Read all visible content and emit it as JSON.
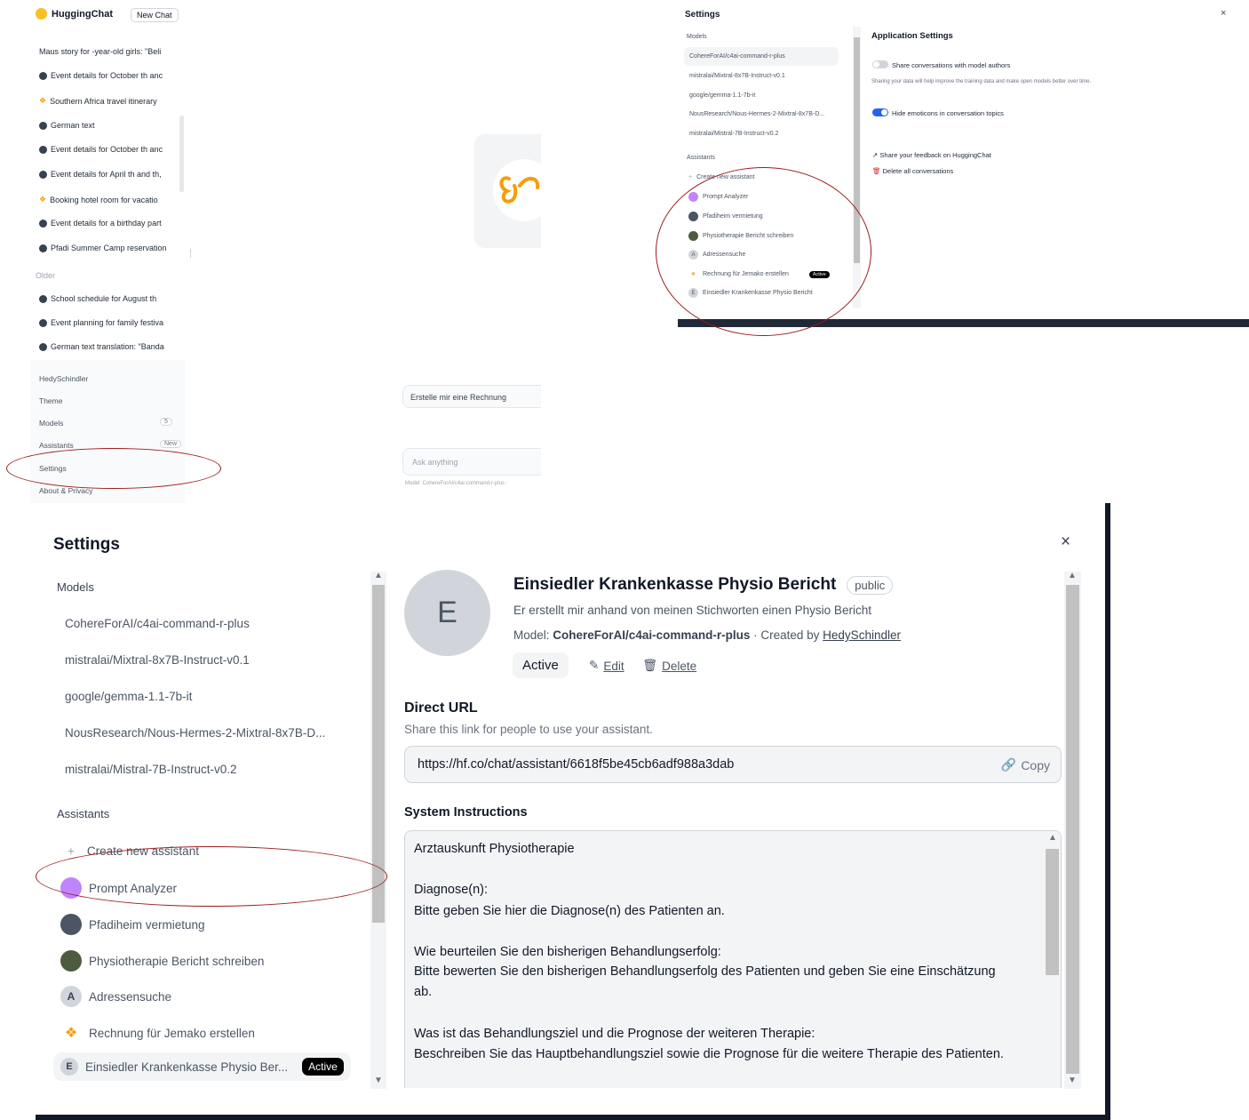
{
  "sidebar": {
    "app_name": "HuggingChat",
    "new_chat_label": "New Chat",
    "conversations": [
      {
        "label": "Maus story for -year-old girls: \"Beli",
        "icon": "none"
      },
      {
        "label": "Event details for October th anc",
        "icon": "dot"
      },
      {
        "label": "Southern Africa travel itinerary",
        "icon": "butterfly"
      },
      {
        "label": "German text",
        "icon": "dot"
      },
      {
        "label": "Event details for October th anc",
        "icon": "dot"
      },
      {
        "label": "Event details for April th and th,",
        "icon": "dot"
      },
      {
        "label": "Booking hotel room for vacatio",
        "icon": "butterfly"
      },
      {
        "label": "Event details for a birthday part",
        "icon": "dot"
      },
      {
        "label": "Pfadi Summer Camp reservation",
        "icon": "dot"
      }
    ],
    "older_label": "Older",
    "older_conversations": [
      {
        "label": "School schedule for August th",
        "icon": "dot"
      },
      {
        "label": "Event planning for family festiva",
        "icon": "dot"
      },
      {
        "label": "German text translation: \"Banda",
        "icon": "dot"
      }
    ],
    "menu": {
      "user": "HedySchindler",
      "theme": "Theme",
      "models": "Models",
      "models_count": "5",
      "assistants": "Assistants",
      "assistants_badge": "New",
      "settings": "Settings",
      "about": "About & Privacy"
    }
  },
  "chat": {
    "suggestion": "Erstelle mir eine Rechnung",
    "input_placeholder": "Ask anything",
    "model_note": "Model: CohereForAI/c4ai-command-r-plus ·"
  },
  "settings_small": {
    "title": "Settings",
    "close": "×",
    "models_label": "Models",
    "models": [
      "CohereForAI/c4ai-command-r-plus",
      "mistralai/Mixtral-8x7B-Instruct-v0.1",
      "google/gemma-1.1-7b-it",
      "NousResearch/Nous-Hermes-2-Mixtral-8x7B-D...",
      "mistralai/Mistral-7B-Instruct-v0.2"
    ],
    "assistants_label": "Assistants",
    "create_label": "Create new assistant",
    "assistants": [
      "Prompt Analyzer",
      "Pfadiheim vermietung",
      "Physiotherapie Bericht schreiben",
      "Adressensuche",
      "Rechnung für Jemako erstellen",
      "Einsiedler Krankenkasse Physio Bericht"
    ],
    "active_badge": "Active",
    "app_settings_title": "Application Settings",
    "share_toggle_label": "Share conversations with model authors",
    "share_toggle_on": false,
    "share_hint": "Sharing your data will help improve the training data and make open models better over time.",
    "emoticons_toggle_label": "Hide emoticons in conversation topics",
    "emoticons_toggle_on": true,
    "feedback_link": "Share your feedback on HuggingChat",
    "delete_all": "Delete all conversations",
    "accent": "#2563eb",
    "danger": "#dc2626"
  },
  "settings_large": {
    "title": "Settings",
    "close": "×",
    "models_label": "Models",
    "models": [
      "CohereForAI/c4ai-command-r-plus",
      "mistralai/Mixtral-8x7B-Instruct-v0.1",
      "google/gemma-1.1-7b-it",
      "NousResearch/Nous-Hermes-2-Mixtral-8x7B-D...",
      "mistralai/Mistral-7B-Instruct-v0.2"
    ],
    "assistants_label": "Assistants",
    "create_label": "Create new assistant",
    "assistants": [
      "Prompt Analyzer",
      "Pfadiheim vermietung",
      "Physiotherapie Bericht schreiben",
      "Adressensuche",
      "Rechnung für Jemako erstellen"
    ],
    "selected_assistant_label": "Einsiedler Krankenkasse Physio Ber...",
    "selected_avatar_letter": "E",
    "active_badge": "Active",
    "assistant": {
      "avatar_letter": "E",
      "name": "Einsiedler Krankenkasse Physio Bericht",
      "visibility": "public",
      "description": "Er erstellt mir anhand von meinen Stichworten einen Physio Bericht",
      "model_prefix": "Model:",
      "model": "CohereForAI/c4ai-command-r-plus",
      "created_prefix": "· Created by",
      "creator": "HedySchindler",
      "active_label": "Active",
      "edit_label": "Edit",
      "delete_label": "Delete"
    },
    "direct_url_title": "Direct URL",
    "direct_url_sub": "Share this link for people to use your assistant.",
    "direct_url": "https://hf.co/chat/assistant/6618f5be45cb6adf988a3dab",
    "copy_label": "Copy",
    "system_title": "System Instructions",
    "system_lines": [
      "Arztauskunft Physiotherapie",
      "",
      "Diagnose(n):",
      "Bitte geben Sie hier die Diagnose(n) des Patienten an.",
      "",
      "Wie beurteilen Sie den bisherigen Behandlungserfolg:",
      "Bitte bewerten Sie den bisherigen Behandlungserfolg des Patienten und geben Sie eine Einschätzung",
      "ab.",
      "",
      "Was ist das Behandlungsziel und die Prognose der weiteren Therapie:",
      "Beschreiben Sie das Hauptbehandlungsziel sowie die Prognose für die weitere Therapie des Patienten."
    ],
    "annotation_color": "#9b1c1c"
  }
}
